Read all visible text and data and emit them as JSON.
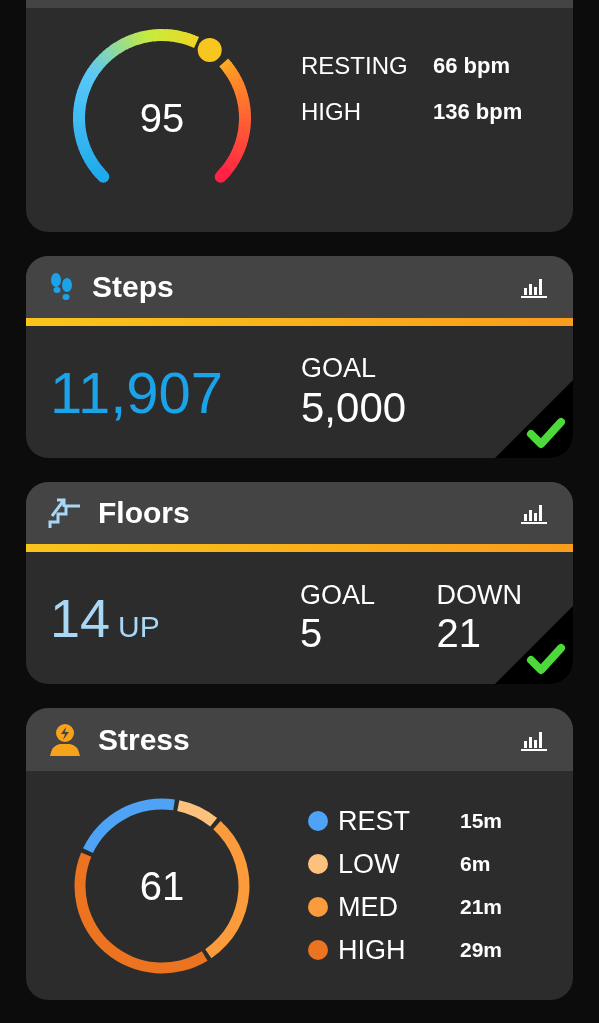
{
  "heart_rate": {
    "reading": "95",
    "stats": [
      {
        "label": "RESTING",
        "value": "66 bpm"
      },
      {
        "label": "HIGH",
        "value": "136 bpm"
      }
    ]
  },
  "cards": [
    {
      "kind": "steps",
      "title": "Steps",
      "level": 1,
      "value": "11,907",
      "goal_label": "GOAL",
      "goal": "5,000",
      "goal_met": true
    },
    {
      "kind": "floors",
      "title": "Floors",
      "level": 1,
      "value": "14",
      "unit": "UP",
      "goal_label": "GOAL",
      "goal": "5",
      "down_label": "DOWN",
      "down": "21",
      "goal_met": true
    }
  ],
  "stress": {
    "title": "Stress",
    "reading": "61",
    "chart_data": {
      "type": "donut",
      "values": [
        21.1,
        8.5,
        29.6,
        40.8
      ]
    },
    "legend": [
      {
        "label": "REST",
        "value": "15m",
        "color": "#4ea3f7"
      },
      {
        "label": "LOW",
        "value": "6m",
        "color": "#fcc17c"
      },
      {
        "label": "MED",
        "value": "21m",
        "color": "#fb9b3b"
      },
      {
        "label": "HIGH",
        "value": "29m",
        "color": "#ec7420"
      }
    ]
  }
}
